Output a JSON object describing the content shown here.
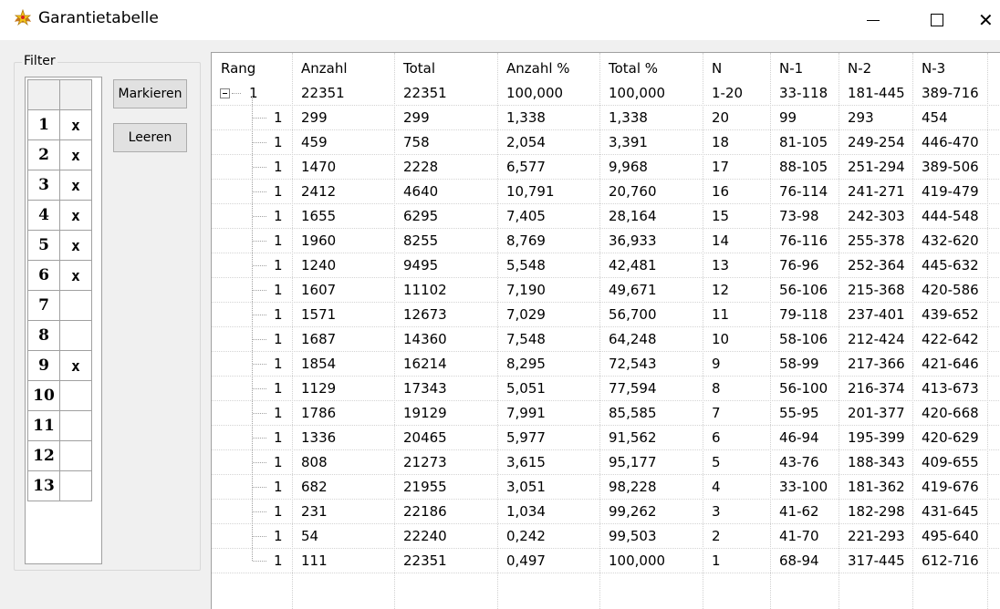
{
  "window": {
    "title": "Garantietabelle"
  },
  "filter": {
    "legend": "Filter",
    "rows": [
      {
        "num": "1",
        "mark": "x"
      },
      {
        "num": "2",
        "mark": "x"
      },
      {
        "num": "3",
        "mark": "x"
      },
      {
        "num": "4",
        "mark": "x"
      },
      {
        "num": "5",
        "mark": "x"
      },
      {
        "num": "6",
        "mark": "x"
      },
      {
        "num": "7",
        "mark": ""
      },
      {
        "num": "8",
        "mark": ""
      },
      {
        "num": "9",
        "mark": "x"
      },
      {
        "num": "10",
        "mark": ""
      },
      {
        "num": "11",
        "mark": ""
      },
      {
        "num": "12",
        "mark": ""
      },
      {
        "num": "13",
        "mark": ""
      }
    ]
  },
  "buttons": {
    "mark": "Markieren",
    "clear": "Leeren"
  },
  "grid": {
    "columns": [
      "Rang",
      "Anzahl",
      "Total",
      "Anzahl %",
      "Total %",
      "N",
      "N-1",
      "N-2",
      "N-3"
    ],
    "root": [
      "1",
      "22351",
      "22351",
      "100,000",
      "100,000",
      "1-20",
      "33-118",
      "181-445",
      "389-716"
    ],
    "rows": [
      [
        "1",
        "299",
        "299",
        "1,338",
        "1,338",
        "20",
        "99",
        "293",
        "454"
      ],
      [
        "1",
        "459",
        "758",
        "2,054",
        "3,391",
        "18",
        "81-105",
        "249-254",
        "446-470"
      ],
      [
        "1",
        "1470",
        "2228",
        "6,577",
        "9,968",
        "17",
        "88-105",
        "251-294",
        "389-506"
      ],
      [
        "1",
        "2412",
        "4640",
        "10,791",
        "20,760",
        "16",
        "76-114",
        "241-271",
        "419-479"
      ],
      [
        "1",
        "1655",
        "6295",
        "7,405",
        "28,164",
        "15",
        "73-98",
        "242-303",
        "444-548"
      ],
      [
        "1",
        "1960",
        "8255",
        "8,769",
        "36,933",
        "14",
        "76-116",
        "255-378",
        "432-620"
      ],
      [
        "1",
        "1240",
        "9495",
        "5,548",
        "42,481",
        "13",
        "76-96",
        "252-364",
        "445-632"
      ],
      [
        "1",
        "1607",
        "11102",
        "7,190",
        "49,671",
        "12",
        "56-106",
        "215-368",
        "420-586"
      ],
      [
        "1",
        "1571",
        "12673",
        "7,029",
        "56,700",
        "11",
        "79-118",
        "237-401",
        "439-652"
      ],
      [
        "1",
        "1687",
        "14360",
        "7,548",
        "64,248",
        "10",
        "58-106",
        "212-424",
        "422-642"
      ],
      [
        "1",
        "1854",
        "16214",
        "8,295",
        "72,543",
        "9",
        "58-99",
        "217-366",
        "421-646"
      ],
      [
        "1",
        "1129",
        "17343",
        "5,051",
        "77,594",
        "8",
        "56-100",
        "216-374",
        "413-673"
      ],
      [
        "1",
        "1786",
        "19129",
        "7,991",
        "85,585",
        "7",
        "55-95",
        "201-377",
        "420-668"
      ],
      [
        "1",
        "1336",
        "20465",
        "5,977",
        "91,562",
        "6",
        "46-94",
        "195-399",
        "420-629"
      ],
      [
        "1",
        "808",
        "21273",
        "3,615",
        "95,177",
        "5",
        "43-76",
        "188-343",
        "409-655"
      ],
      [
        "1",
        "682",
        "21955",
        "3,051",
        "98,228",
        "4",
        "33-100",
        "181-362",
        "419-676"
      ],
      [
        "1",
        "231",
        "22186",
        "1,034",
        "99,262",
        "3",
        "41-62",
        "182-298",
        "431-645"
      ],
      [
        "1",
        "54",
        "22240",
        "0,242",
        "99,503",
        "2",
        "41-70",
        "221-293",
        "495-640"
      ],
      [
        "1",
        "111",
        "22351",
        "0,497",
        "100,000",
        "1",
        "68-94",
        "317-445",
        "612-716"
      ]
    ]
  },
  "icons": {
    "app": "star-award-icon",
    "expander": "collapse-minus-icon"
  }
}
